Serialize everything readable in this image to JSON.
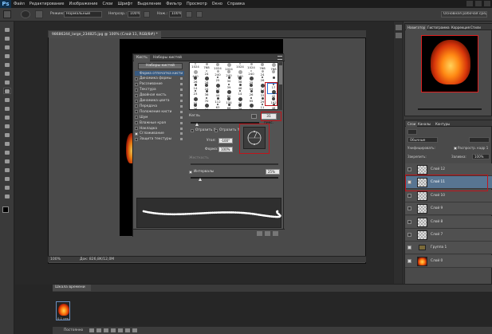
{
  "app": {
    "logo": "Ps"
  },
  "menu": [
    "Файл",
    "Редактирование",
    "Изображение",
    "Слои",
    "Шрифт",
    "Выделение",
    "Фильтр",
    "Просмотр",
    "Окно",
    "Справка"
  ],
  "options": {
    "mode_label": "Режим:",
    "mode_value": "Нормальный",
    "opacity_label": "Непрозр.:",
    "opacity_value": "100%",
    "flow_label": "Наж.:",
    "flow_value": "100%",
    "workspace_value": "Основная рабочая среда"
  },
  "document": {
    "tab_title": "98686244_large_234825.jpg @ 100% (Слой 11, RGB/8#) *",
    "zoom": "100%",
    "status": "Док: 826,8K/12,0M"
  },
  "brush_panel": {
    "tabs": [
      "Кисть",
      "Наборы кистей"
    ],
    "presets_button": "Наборы кистей",
    "options": [
      {
        "label": "Форма отпечатка кисти",
        "checked": false,
        "selected": true
      },
      {
        "label": "Динамика формы",
        "checked": false,
        "selected": false
      },
      {
        "label": "Рассеивание",
        "checked": false,
        "selected": false
      },
      {
        "label": "Текстура",
        "checked": false,
        "selected": false
      },
      {
        "label": "Двойная кисть",
        "checked": false,
        "selected": false
      },
      {
        "label": "Динамика цвета",
        "checked": false,
        "selected": false
      },
      {
        "label": "Передача",
        "checked": false,
        "selected": false
      },
      {
        "label": "Положение кисти",
        "checked": false,
        "selected": false
      },
      {
        "label": "Шум",
        "checked": false,
        "selected": false
      },
      {
        "label": "Влажные края",
        "checked": false,
        "selected": false
      },
      {
        "label": "Накладка",
        "checked": false,
        "selected": false
      },
      {
        "label": "Сглаживание",
        "checked": true,
        "selected": false
      },
      {
        "label": "Защита текстуры",
        "checked": false,
        "selected": false
      }
    ],
    "tip_sizes": [
      [
        "1024",
        "768",
        "1024",
        "1024",
        "1024",
        "1024",
        "768",
        "768"
      ],
      [
        "440",
        "24",
        "240",
        "240",
        "240",
        "240",
        "24",
        ""
      ],
      [
        "26",
        "28",
        "25",
        "30",
        "38",
        "25",
        "26",
        ""
      ],
      [
        "14",
        "24",
        "27",
        "39",
        "46",
        "59",
        "11",
        "17"
      ],
      [
        "23",
        "36",
        "44",
        "60",
        "14",
        "26",
        "33",
        "42"
      ],
      [
        "55",
        "70",
        "112",
        "134",
        "74",
        "95",
        "29",
        "192"
      ],
      [
        "36",
        "33",
        "63",
        "66",
        "39",
        "63",
        "11",
        "48"
      ]
    ],
    "size_label": "Кегль",
    "size_value": "31 пикс.",
    "flip_x": "Отразить X",
    "flip_y": "Отразить Y",
    "angle_label": "Угол:",
    "angle_value": "-100°",
    "roundness_label": "Форма:",
    "roundness_value": "100%",
    "hardness_label": "Жесткость",
    "spacing_label": "Интервалы",
    "spacing_value": "25%",
    "spacing_checked": true
  },
  "navigator": {
    "tabs": [
      "Навигатор",
      "Гистограмма",
      "Коррекция",
      "Стили"
    ]
  },
  "layers_panel": {
    "tabs": [
      "Слои",
      "Каналы",
      "Контуры"
    ],
    "blend_mode": "Обычные",
    "unify_label": "Унифицировать:",
    "propagate_label": "Распростр. кадр 1",
    "lock_label": "Закрепить:",
    "fill_label": "Заливка:",
    "fill_value": "100%",
    "layers": [
      {
        "name": "Слой 12",
        "visible": false,
        "selected": false,
        "kind": "empty"
      },
      {
        "name": "Слой 11",
        "visible": true,
        "selected": true,
        "kind": "empty"
      },
      {
        "name": "Слой 10",
        "visible": false,
        "selected": false,
        "kind": "empty"
      },
      {
        "name": "Слой 9",
        "visible": false,
        "selected": false,
        "kind": "empty"
      },
      {
        "name": "Слой 8",
        "visible": false,
        "selected": false,
        "kind": "empty"
      },
      {
        "name": "Слой 7",
        "visible": false,
        "selected": false,
        "kind": "empty"
      },
      {
        "name": "Группа 1",
        "visible": true,
        "selected": false,
        "kind": "group"
      },
      {
        "name": "Слой 0",
        "visible": true,
        "selected": false,
        "kind": "image"
      }
    ]
  },
  "timeline": {
    "title": "Шкала времени",
    "frame_time": "0,1 сек.",
    "loop": "Постоянно"
  },
  "colors": {
    "accent_red": "#c0141b",
    "selection_blue": "#587592"
  }
}
